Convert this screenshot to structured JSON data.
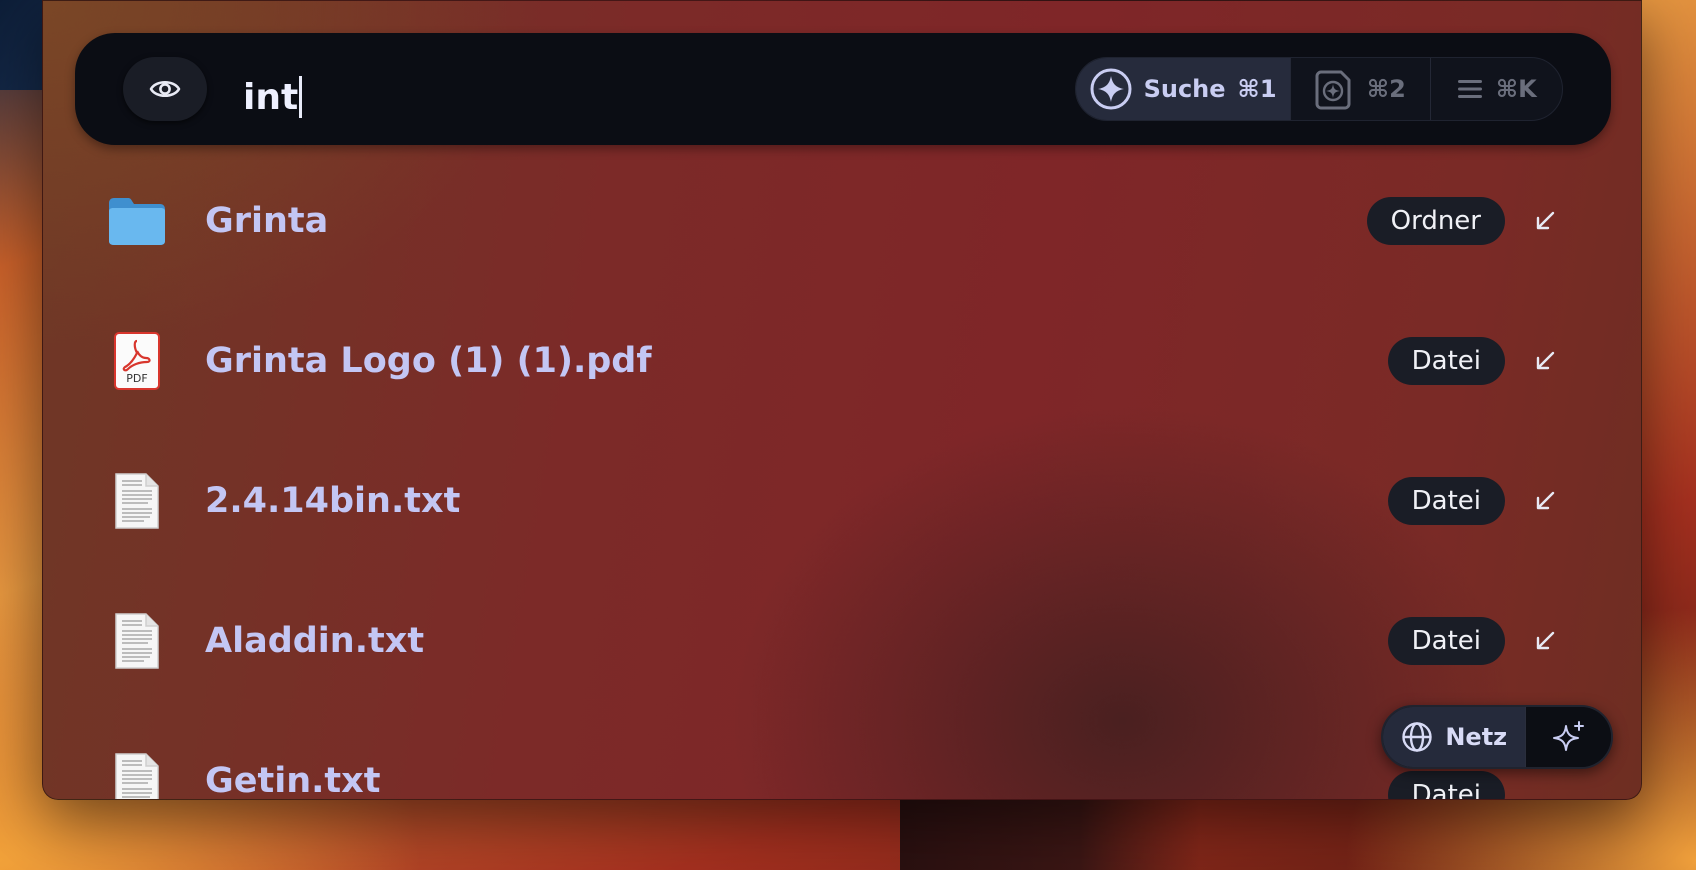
{
  "search": {
    "query": "int",
    "placeholder": ""
  },
  "modes": [
    {
      "icon": "sparkle-circle-icon",
      "label": "Suche",
      "shortcut": "⌘1",
      "active": true
    },
    {
      "icon": "ai-document-icon",
      "label": "",
      "shortcut": "⌘2",
      "active": false
    },
    {
      "icon": "menu-lines-icon",
      "label": "",
      "shortcut": "⌘K",
      "active": false
    }
  ],
  "results": [
    {
      "title": "Grinta",
      "kind": "Ordner",
      "icon": "folder-icon"
    },
    {
      "title": "Grinta Logo (1) (1).pdf",
      "kind": "Datei",
      "icon": "pdf-file-icon"
    },
    {
      "title": "2.4.14bin.txt",
      "kind": "Datei",
      "icon": "text-file-icon"
    },
    {
      "title": "Aladdin.txt",
      "kind": "Datei",
      "icon": "text-file-icon"
    },
    {
      "title": "Getin.txt",
      "kind": "Datei",
      "icon": "text-file-icon"
    }
  ],
  "pdf_icon_label": "PDF",
  "bottom": {
    "net_label": "Netz"
  },
  "colors": {
    "accent": "#c3c6f4",
    "bar_background": "#0b0d14",
    "badge_background": "#1a1d26"
  }
}
